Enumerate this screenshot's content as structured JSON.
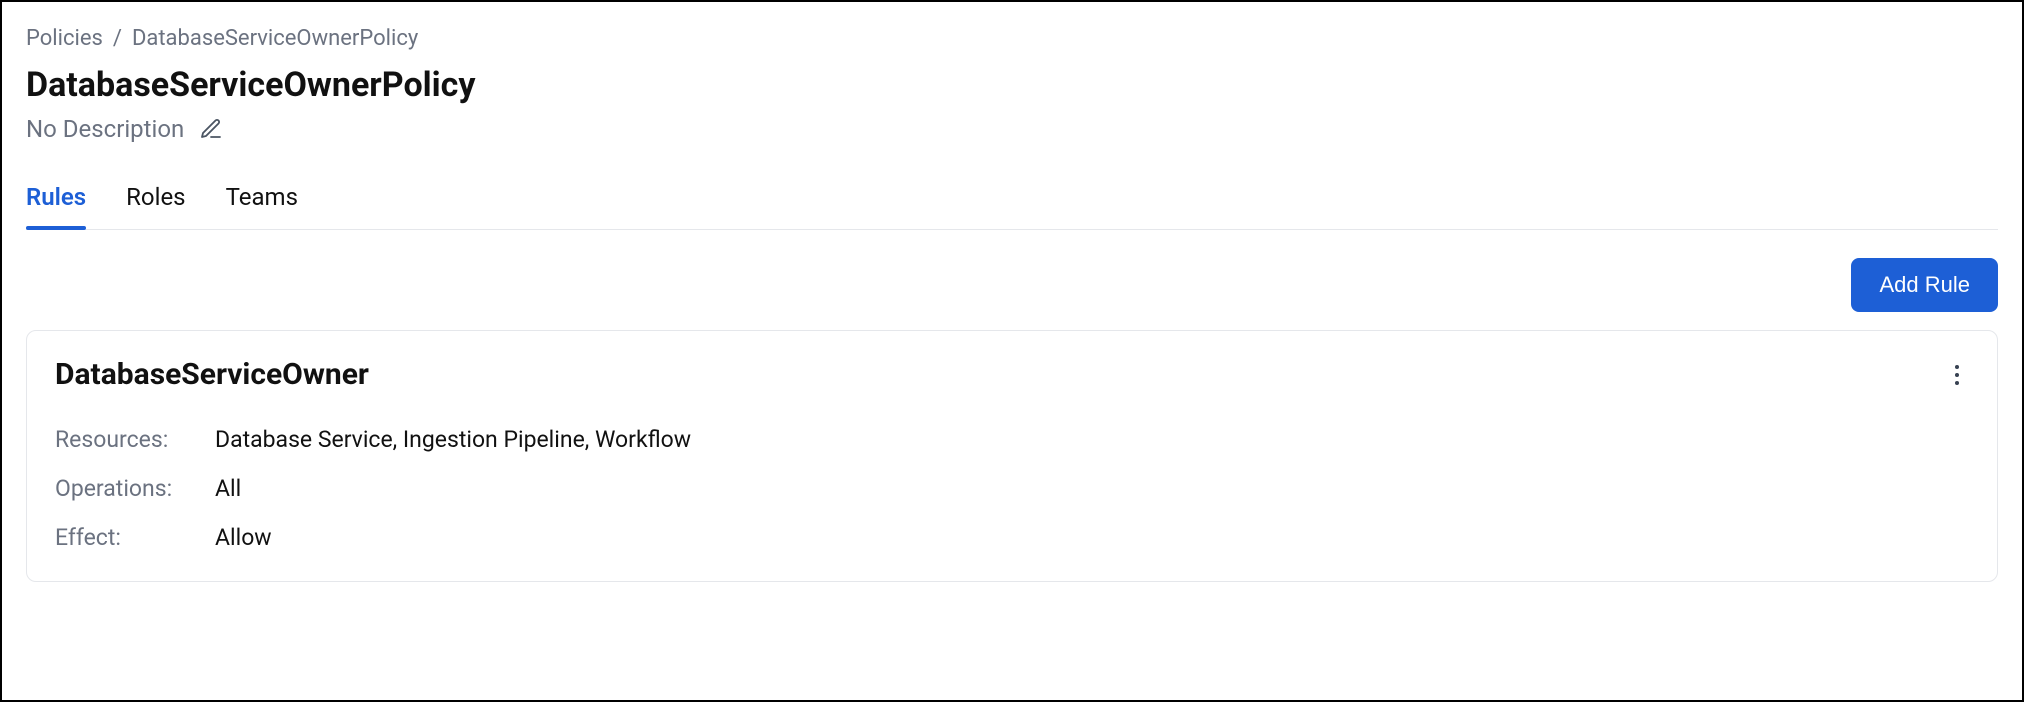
{
  "breadcrumb": {
    "root": "Policies",
    "separator": "/",
    "current": "DatabaseServiceOwnerPolicy"
  },
  "page": {
    "title": "DatabaseServiceOwnerPolicy",
    "description": "No Description"
  },
  "tabs": [
    {
      "label": "Rules",
      "active": true
    },
    {
      "label": "Roles",
      "active": false
    },
    {
      "label": "Teams",
      "active": false
    }
  ],
  "actions": {
    "add_rule": "Add Rule"
  },
  "rule": {
    "name": "DatabaseServiceOwner",
    "fields": {
      "resources_label": "Resources:",
      "resources_value": "Database Service, Ingestion Pipeline, Workflow",
      "operations_label": "Operations:",
      "operations_value": "All",
      "effect_label": "Effect:",
      "effect_value": "Allow"
    }
  }
}
